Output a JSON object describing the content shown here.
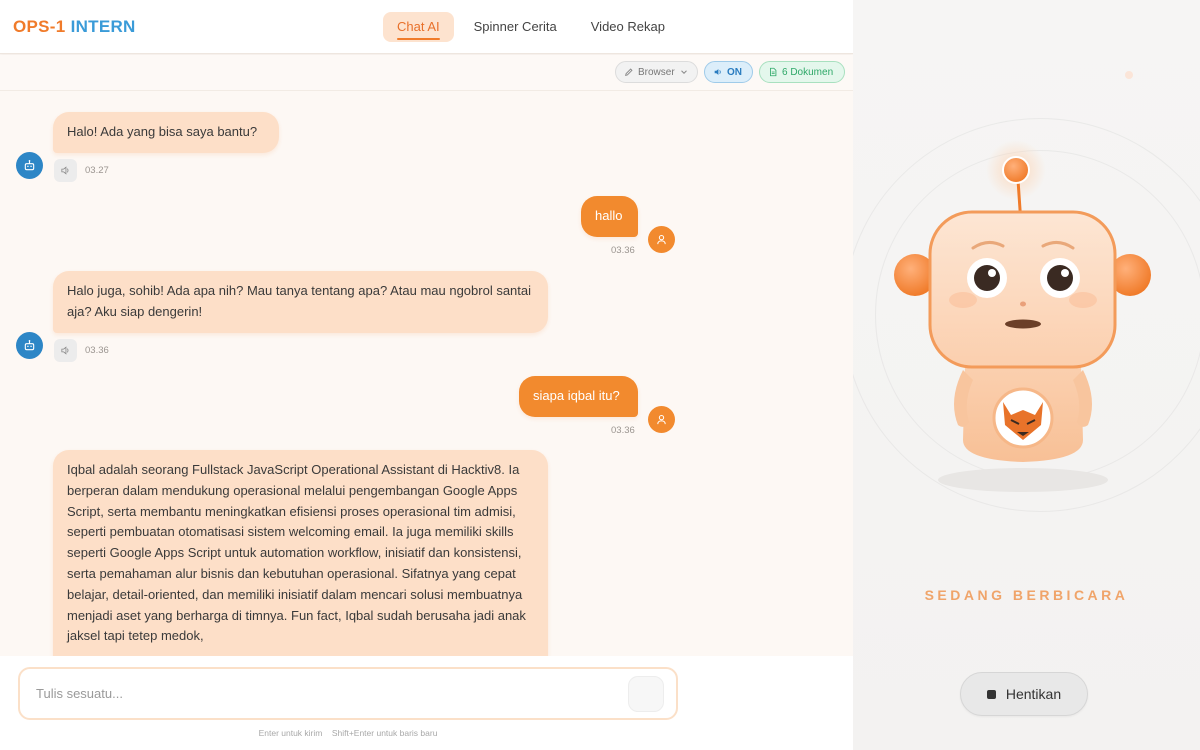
{
  "brand": {
    "part1": "OPS-1",
    "part2": "INTERN"
  },
  "tabs": [
    {
      "label": "Chat AI",
      "active": true
    },
    {
      "label": "Spinner Cerita",
      "active": false
    },
    {
      "label": "Video Rekap",
      "active": false
    }
  ],
  "toolbar": {
    "browser_label": "Browser",
    "on_label": "ON",
    "docs_label": "6 Dokumen"
  },
  "messages": [
    {
      "role": "bot",
      "text": "Halo! Ada yang bisa saya bantu?",
      "time": "03.27"
    },
    {
      "role": "user",
      "text": "hallo",
      "time": "03.36"
    },
    {
      "role": "bot",
      "text": "Halo juga, sohib! Ada apa nih? Mau tanya tentang apa? Atau mau ngobrol santai aja? Aku siap dengerin!",
      "time": "03.36"
    },
    {
      "role": "user",
      "text": "siapa iqbal itu?",
      "time": "03.36"
    },
    {
      "role": "bot",
      "text": "Iqbal adalah seorang Fullstack JavaScript Operational Assistant di Hacktiv8. Ia berperan dalam mendukung operasional melalui pengembangan Google Apps Script, serta membantu meningkatkan efisiensi proses operasional tim admisi, seperti pembuatan otomatisasi sistem welcoming email. Ia juga memiliki skills seperti Google Apps Script untuk automation workflow, inisiatif dan konsistensi, serta pemahaman alur bisnis dan kebutuhan operasional. Sifatnya yang cepat belajar, detail-oriented, dan memiliki inisiatif dalam mencari solusi membuatnya menjadi aset yang berharga di timnya. Fun fact, Iqbal sudah berusaha jadi anak jaksel tapi tetep medok,",
      "time": ""
    }
  ],
  "composer": {
    "placeholder": "Tulis sesuatu...",
    "hint_enter": "Enter untuk kirim",
    "hint_shift": "Shift+Enter untuk baris baru"
  },
  "assistant_panel": {
    "status": "SEDANG BERBICARA",
    "stop_label": "Hentikan"
  },
  "colors": {
    "accent": "#f07b2a",
    "brand_blue": "#3a9bd8",
    "bot_bubble": "#fddfc8",
    "user_bubble": "#f28a2e"
  },
  "icons": {
    "bot_avatar": "robot-icon",
    "user_avatar": "user-icon",
    "speaker": "speaker-icon",
    "browser": "pencil-icon",
    "docs": "document-icon"
  }
}
